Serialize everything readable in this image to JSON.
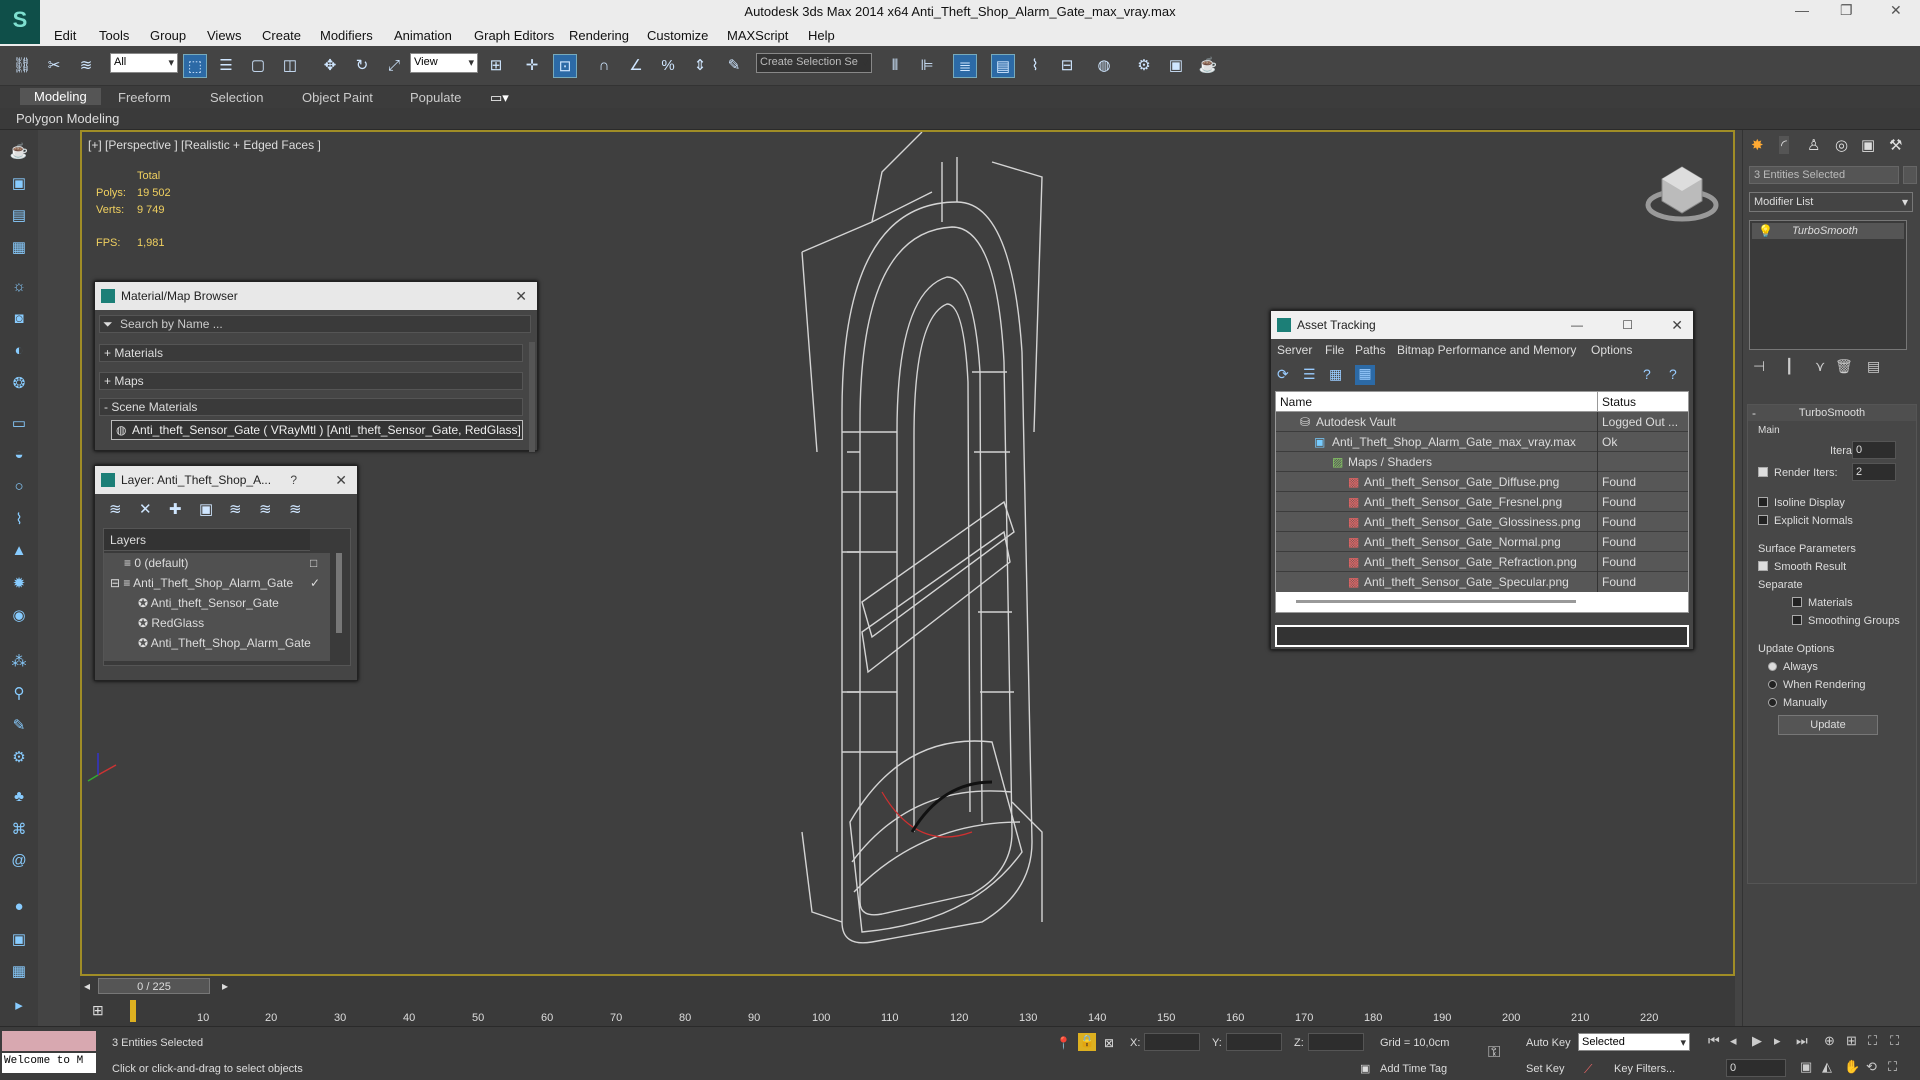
{
  "window": {
    "title": "Autodesk 3ds Max  2014 x64     Anti_Theft_Shop_Alarm_Gate_max_vray.max",
    "min": "—",
    "max": "❐",
    "close": "✕"
  },
  "menu": [
    "Edit",
    "Tools",
    "Group",
    "Views",
    "Create",
    "Modifiers",
    "Animation",
    "Graph Editors",
    "Rendering",
    "Customize",
    "MAXScript",
    "Help"
  ],
  "toolbar": {
    "filter": "All",
    "refcoord": "View",
    "selset": "Create Selection Se"
  },
  "ribbon": {
    "tabs": [
      "Modeling",
      "Freeform",
      "Selection",
      "Object Paint",
      "Populate"
    ],
    "sub": "Polygon Modeling"
  },
  "viewport": {
    "label": "[+] [Perspective ] [Realistic + Edged Faces ]",
    "total": "Total",
    "polys_label": "Polys:",
    "polys": "19 502",
    "verts_label": "Verts:",
    "verts": "9 749",
    "fps_label": "FPS:",
    "fps": "1,981"
  },
  "matbrowser": {
    "title": "Material/Map Browser",
    "search": "Search by Name ...",
    "materials": "+ Materials",
    "maps": "+ Maps",
    "scene": "- Scene Materials",
    "item": "Anti_theft_Sensor_Gate ( VRayMtl ) [Anti_theft_Sensor_Gate, RedGlass]"
  },
  "layer": {
    "title": "Layer: Anti_Theft_Shop_A...",
    "help": "?",
    "header": "Layers",
    "items": [
      "0 (default)",
      "Anti_Theft_Shop_Alarm_Gate",
      "Anti_theft_Sensor_Gate",
      "RedGlass",
      "Anti_Theft_Shop_Alarm_Gate"
    ]
  },
  "asset": {
    "title": "Asset Tracking",
    "menu": [
      "Server",
      "File",
      "Paths",
      "Bitmap Performance and Memory",
      "Options"
    ],
    "col_name": "Name",
    "col_status": "Status",
    "rows": [
      {
        "name": "Autodesk Vault",
        "status": "Logged Out ..."
      },
      {
        "name": "Anti_Theft_Shop_Alarm_Gate_max_vray.max",
        "status": "Ok"
      },
      {
        "name": "Maps / Shaders",
        "status": ""
      },
      {
        "name": "Anti_theft_Sensor_Gate_Diffuse.png",
        "status": "Found"
      },
      {
        "name": "Anti_theft_Sensor_Gate_Fresnel.png",
        "status": "Found"
      },
      {
        "name": "Anti_theft_Sensor_Gate_Glossiness.png",
        "status": "Found"
      },
      {
        "name": "Anti_theft_Sensor_Gate_Normal.png",
        "status": "Found"
      },
      {
        "name": "Anti_theft_Sensor_Gate_Refraction.png",
        "status": "Found"
      },
      {
        "name": "Anti_theft_Sensor_Gate_Specular.png",
        "status": "Found"
      }
    ]
  },
  "cmd": {
    "selected": "3 Entities Selected",
    "modlist": "Modifier List",
    "stack_item": "TurboSmooth",
    "rollout": "TurboSmooth",
    "main": "Main",
    "iterations_label": "Iterations:",
    "iterations": "0",
    "render_iters_label": "Render Iters:",
    "render_iters": "2",
    "isoline": "Isoline Display",
    "explicit": "Explicit Normals",
    "surface": "Surface Parameters",
    "smooth": "Smooth Result",
    "separate": "Separate",
    "materials": "Materials",
    "smoothing": "Smoothing Groups",
    "update_opts": "Update Options",
    "always": "Always",
    "when_rendering": "When Rendering",
    "manually": "Manually",
    "update": "Update"
  },
  "timeline": {
    "frame": "0 / 225",
    "ticks": [
      "10",
      "20",
      "30",
      "40",
      "50",
      "60",
      "70",
      "80",
      "90",
      "100",
      "110",
      "120",
      "130",
      "140",
      "150",
      "160",
      "170",
      "180",
      "190",
      "200",
      "210",
      "220"
    ]
  },
  "status": {
    "welcome": "Welcome to M",
    "selected": "3 Entities Selected",
    "prompt": "Click or click-and-drag to select objects",
    "x": "X:",
    "y": "Y:",
    "z": "Z:",
    "grid": "Grid = 10,0cm",
    "autokey": "Auto Key",
    "setkey": "Set Key",
    "keymode": "Selected",
    "keyfilters": "Key Filters...",
    "addtime": "Add Time Tag",
    "frame": "0"
  }
}
